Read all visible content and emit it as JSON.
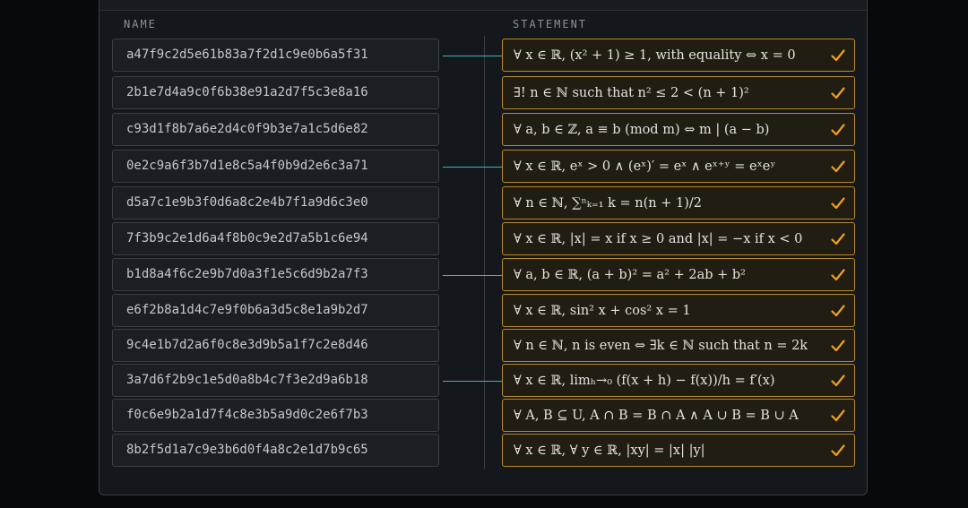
{
  "headers": {
    "name": "NAME",
    "statement": "STATEMENT"
  },
  "accent_colors": {
    "statement_border": "#b98a23",
    "check": "#f0a21c",
    "connector": "#3cb3c4"
  },
  "rows": [
    {
      "name": "a47f9c2d5e61b83a7f2d1c9e0b6a5f31",
      "statement": "∀ x ∈ ℝ, (x² + 1) ≥ 1, with equality ⇔ x = 0",
      "connected": true
    },
    {
      "name": "2b1e7d4a9c0f6b38e91a2d7f5c3e8a16",
      "statement": "∃! n ∈ ℕ such that n² ≤ 2 < (n + 1)²",
      "connected": false
    },
    {
      "name": "c93d1f8b7a6e2d4c0f9b3e7a1c5d6e82",
      "statement": "∀ a, b ∈ ℤ, a ≡ b (mod m) ⇔ m | (a − b)",
      "connected": false
    },
    {
      "name": "0e2c9a6f3b7d1e8c5a4f0b9d2e6c3a71",
      "statement": "∀ x ∈ ℝ, eˣ > 0 ∧ (eˣ)′ = eˣ ∧ eˣ⁺ʸ = eˣeʸ",
      "connected": true
    },
    {
      "name": "d5a7c1e9b3f0d6a8c2e4b7f1a9d6c3e0",
      "statement": "∀ n ∈ ℕ, ∑ⁿₖ₌₁ k = n(n + 1)/2",
      "connected": false
    },
    {
      "name": "7f3b9c2e1d6a4f8b0c9e2d7a5b1c6e94",
      "statement": "∀ x ∈ ℝ, |x| = x if x ≥ 0 and |x| = −x if x < 0",
      "connected": false
    },
    {
      "name": "b1d8a4f6c2e9b7d0a3f1e5c6d9b2a7f3",
      "statement": "∀ a, b ∈ ℝ, (a + b)² = a² + 2ab + b²",
      "connected": true
    },
    {
      "name": "e6f2b8a1d4c7e9f0b6a3d5c8e1a9b2d7",
      "statement": "∀ x ∈ ℝ, sin² x + cos² x = 1",
      "connected": false
    },
    {
      "name": "9c4e1b7d2a6f0c8e3d9b5a1f7c2e8d46",
      "statement": "∀ n ∈ ℕ, n is even ⇔ ∃k ∈ ℕ such that n = 2k",
      "connected": false
    },
    {
      "name": "3a7d6f2b9c1e5d0a8b4c7f3e2d9a6b18",
      "statement": "∀ x ∈ ℝ, limₕ→₀ (f(x + h) − f(x))/h = f′(x)",
      "connected": true
    },
    {
      "name": "f0c6e9b2a1d7f4c8e3b5a9d0c2e6f7b3",
      "statement": "∀ A, B ⊆ U, A ∩ B = B ∩ A ∧ A ∪ B = B ∪ A",
      "connected": false
    },
    {
      "name": "8b2f5d1a7c9e3b6d0f4a8c2e1d7b9c65",
      "statement": "∀ x ∈ ℝ, ∀ y ∈ ℝ, |xy| = |x| |y|",
      "connected": false
    }
  ]
}
